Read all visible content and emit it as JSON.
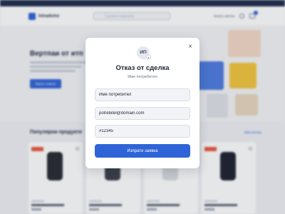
{
  "background": {
    "logo_text": "Intradomo",
    "search_placeholder": "Търсене в магазина",
    "account_label": "Моята сметка",
    "hero_title": "Вертпаи от итп",
    "hero_button": "Вижте повече",
    "section_title": "Популярни продукти",
    "section_link": "Виж всички"
  },
  "modal": {
    "avatar_initials": "ИП",
    "title": "Отказ от сделка",
    "subtitle": "Име потребител",
    "fields": [
      {
        "value": "Име потребител"
      },
      {
        "value": "potrebitel@domain.com"
      },
      {
        "value": "#12345"
      }
    ],
    "submit_label": "Изпрати заявка",
    "close_symbol": "×"
  },
  "colors": {
    "accent": "#2f63d8",
    "sale_badge": "#e8593c",
    "overlay": "rgba(40,46,60,0.12)"
  },
  "icons": [
    "close-icon",
    "user-badge-icon",
    "search-icon",
    "account-icon",
    "cart-icon",
    "heart-icon"
  ]
}
